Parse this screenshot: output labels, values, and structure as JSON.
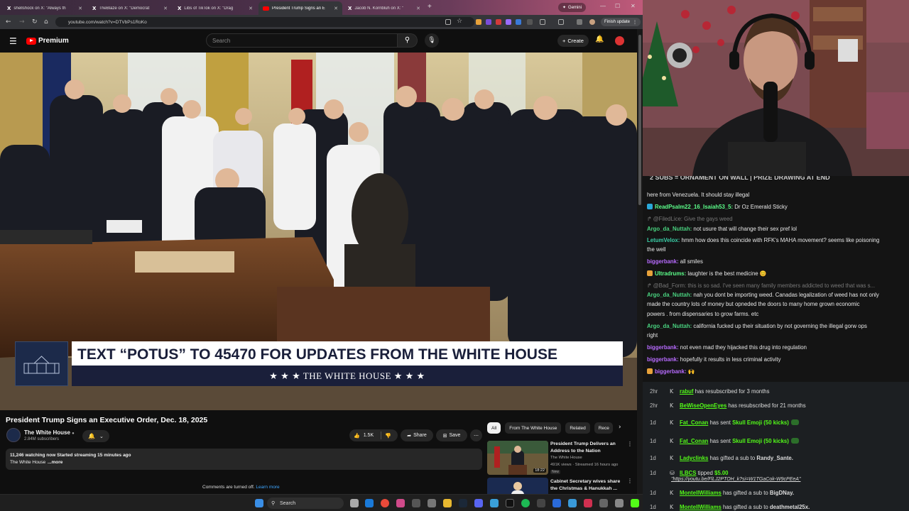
{
  "browser": {
    "tabs": [
      {
        "label": "shellshock on X: \"Always th",
        "icon": "x-icon"
      },
      {
        "label": "TheBlaze on X: \"Democrat",
        "icon": "x-icon"
      },
      {
        "label": "Libs of TikTok on X: \"Drag",
        "icon": "x-icon"
      },
      {
        "label": "President Trump Signs an E",
        "icon": "youtube-icon",
        "active": true
      },
      {
        "label": "Jacob N. Kornbluh on X: \"",
        "icon": "x-icon"
      }
    ],
    "gemini_label": "Gemini",
    "url": "youtube.com/watch?v=DTVbPs1RoKo",
    "finish_update": "Finish update"
  },
  "youtube": {
    "logo_text": "Premium",
    "search_placeholder": "Search",
    "create_label": "Create",
    "banner": {
      "line1": "TEXT “POTUS” TO 45470 FOR UPDATES FROM THE WHITE HOUSE",
      "line2": "★ ★ ★  THE WHITE HOUSE  ★ ★ ★"
    },
    "video_title": "President Trump Signs an Executive Order, Dec. 18, 2025",
    "channel_name": "The White House",
    "channel_subs": "2.84M subscribers",
    "likes": "1.5K",
    "share_label": "Share",
    "save_label": "Save",
    "description_line1": "11,246 watching now  Started streaming 15 minutes ago",
    "description_line2": "The White House",
    "description_more": "...more",
    "comments_off": "Comments are turned off.",
    "learn_more": "Learn more",
    "chips": [
      "All",
      "From The White House",
      "Related",
      "Rece"
    ],
    "recommendations": [
      {
        "title": "President Trump Delivers an Address to the Nation",
        "channel": "The White House",
        "meta": "491K views · Streamed 16 hours ago",
        "badge": "New",
        "duration": "18:22"
      },
      {
        "title": "Cabinet Secretary wives share the Christmas & Hanukkah ..."
      }
    ]
  },
  "chat": {
    "header": "2 SUBS = ORNAMENT ON WALL | PRIZE DRAWING AT END",
    "messages": [
      {
        "user": "",
        "text": "here from Venezuela. It should stay illegal"
      },
      {
        "user": "ReadPsalm22_16_Isaiah53_5:",
        "text": " Dr Oz Emerald Sticky",
        "color": "#5cff8a"
      },
      {
        "user": "@FiledLice:",
        "text": " Give the gays weed",
        "dim": true
      },
      {
        "user": "Argo_da_Nuttah:",
        "text": " not usure that will change their sex pref lol",
        "color": "#49d27f"
      },
      {
        "user": "LetumVelox:",
        "text": " hmm how does this coincide with RFK's MAHA movement? seems like poisoning",
        "color": "#3ad0a8"
      },
      {
        "user": "",
        "text": "the well"
      },
      {
        "user": "biggerbank:",
        "text": " all smiles",
        "color": "#b86bff"
      },
      {
        "user": "Ultradrums:",
        "text": " laughter is the best medicine 😊",
        "color": "#5cff8a"
      },
      {
        "user": "@Bad_Form:",
        "text": " this is so sad. I've seen many family members addicted to weed that was s...",
        "dim": true
      },
      {
        "user": "Argo_da_Nuttah:",
        "text": " nah you dont be importing weed. Canadas legalization of weed has not only",
        "color": "#49d27f"
      },
      {
        "user": "",
        "text": "made the country lots of money but opneded the doors to many home grown economic"
      },
      {
        "user": "",
        "text": "powers . from dispensaries to grow farms. etc"
      },
      {
        "user": "Argo_da_Nuttah:",
        "text": " california fucked up their situation by not governing the illegal gorw ops",
        "color": "#49d27f"
      },
      {
        "user": "",
        "text": "right"
      },
      {
        "user": "biggerbank:",
        "text": " not even mad they hijacked this drug into regulation",
        "color": "#b86bff"
      },
      {
        "user": "biggerbank:",
        "text": " hopefully it results in less criminal activity",
        "color": "#b86bff"
      },
      {
        "user": "biggerbank:",
        "text": " 🙌",
        "color": "#b86bff"
      }
    ]
  },
  "events": [
    {
      "time": "2hr",
      "name": "rabuf",
      "text": " has resubscribed for 3 months"
    },
    {
      "time": "2hr",
      "name": "BeWiseOpenEyes",
      "text": " has resubscribed for 21 months"
    },
    {
      "time": "1d",
      "name": "Fat_Conan",
      "text": " has sent ",
      "highlight": "Skull Emoji (50 kicks)"
    },
    {
      "time": "1d",
      "name": "Fat_Conan",
      "text": " has sent ",
      "highlight": "Skull Emoji (50 kicks)"
    },
    {
      "time": "1d",
      "name": "Ladyclinks",
      "text": " has gifted a sub to ",
      "target": "Randy_Sante."
    },
    {
      "time": "1d",
      "name": "ILBCS",
      "text": " tipped ",
      "highlight": "$5.00",
      "link": "\"https://youtu.be/FlLJ2PTOH_k?si=W1TGaCok-W9cPEeA\""
    },
    {
      "time": "1d",
      "name": "MontellWilliams",
      "text": " has gifted a sub to ",
      "target": "BigDNay."
    },
    {
      "time": "1d",
      "name": "MontellWilliams",
      "text": " has gifted a sub to ",
      "target": "deathmetal25x."
    }
  ],
  "taskbar": {
    "search": "Search"
  }
}
